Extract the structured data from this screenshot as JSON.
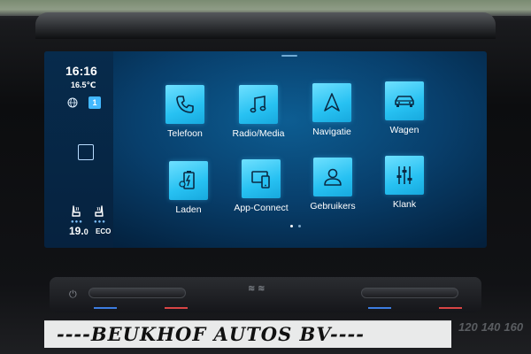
{
  "status": {
    "time": "16:16",
    "outside_temp": "16.5℃",
    "profile_badge": "1",
    "globe_icon": "globe-icon"
  },
  "climate": {
    "temp_whole": "19.",
    "temp_decimal": "0",
    "mode": "ECO",
    "seat_icons": [
      "seat-heat-left-icon",
      "seat-heat-right-icon"
    ]
  },
  "apps": [
    {
      "label": "Telefoon",
      "icon": "phone-icon"
    },
    {
      "label": "Radio/Media",
      "icon": "music-note-icon"
    },
    {
      "label": "Navigatie",
      "icon": "navigation-arrow-icon"
    },
    {
      "label": "Wagen",
      "icon": "car-icon"
    },
    {
      "label": "Laden",
      "icon": "battery-charge-icon"
    },
    {
      "label": "App-Connect",
      "icon": "app-connect-icon"
    },
    {
      "label": "Gebruikers",
      "icon": "user-icon"
    },
    {
      "label": "Klank",
      "icon": "equalizer-icon"
    }
  ],
  "pager": {
    "pages": 2,
    "current": 1
  },
  "controls": {
    "power_icon": "power-icon"
  },
  "colors": {
    "tile_accent": "#27c1f2",
    "screen_bg": "#083f6c",
    "badge": "#43b8ff"
  },
  "footer": {
    "dealer_text": "----BEUKHOF AUTOS BV----"
  },
  "gauge": {
    "ticks": [
      "120",
      "140",
      "160"
    ]
  }
}
